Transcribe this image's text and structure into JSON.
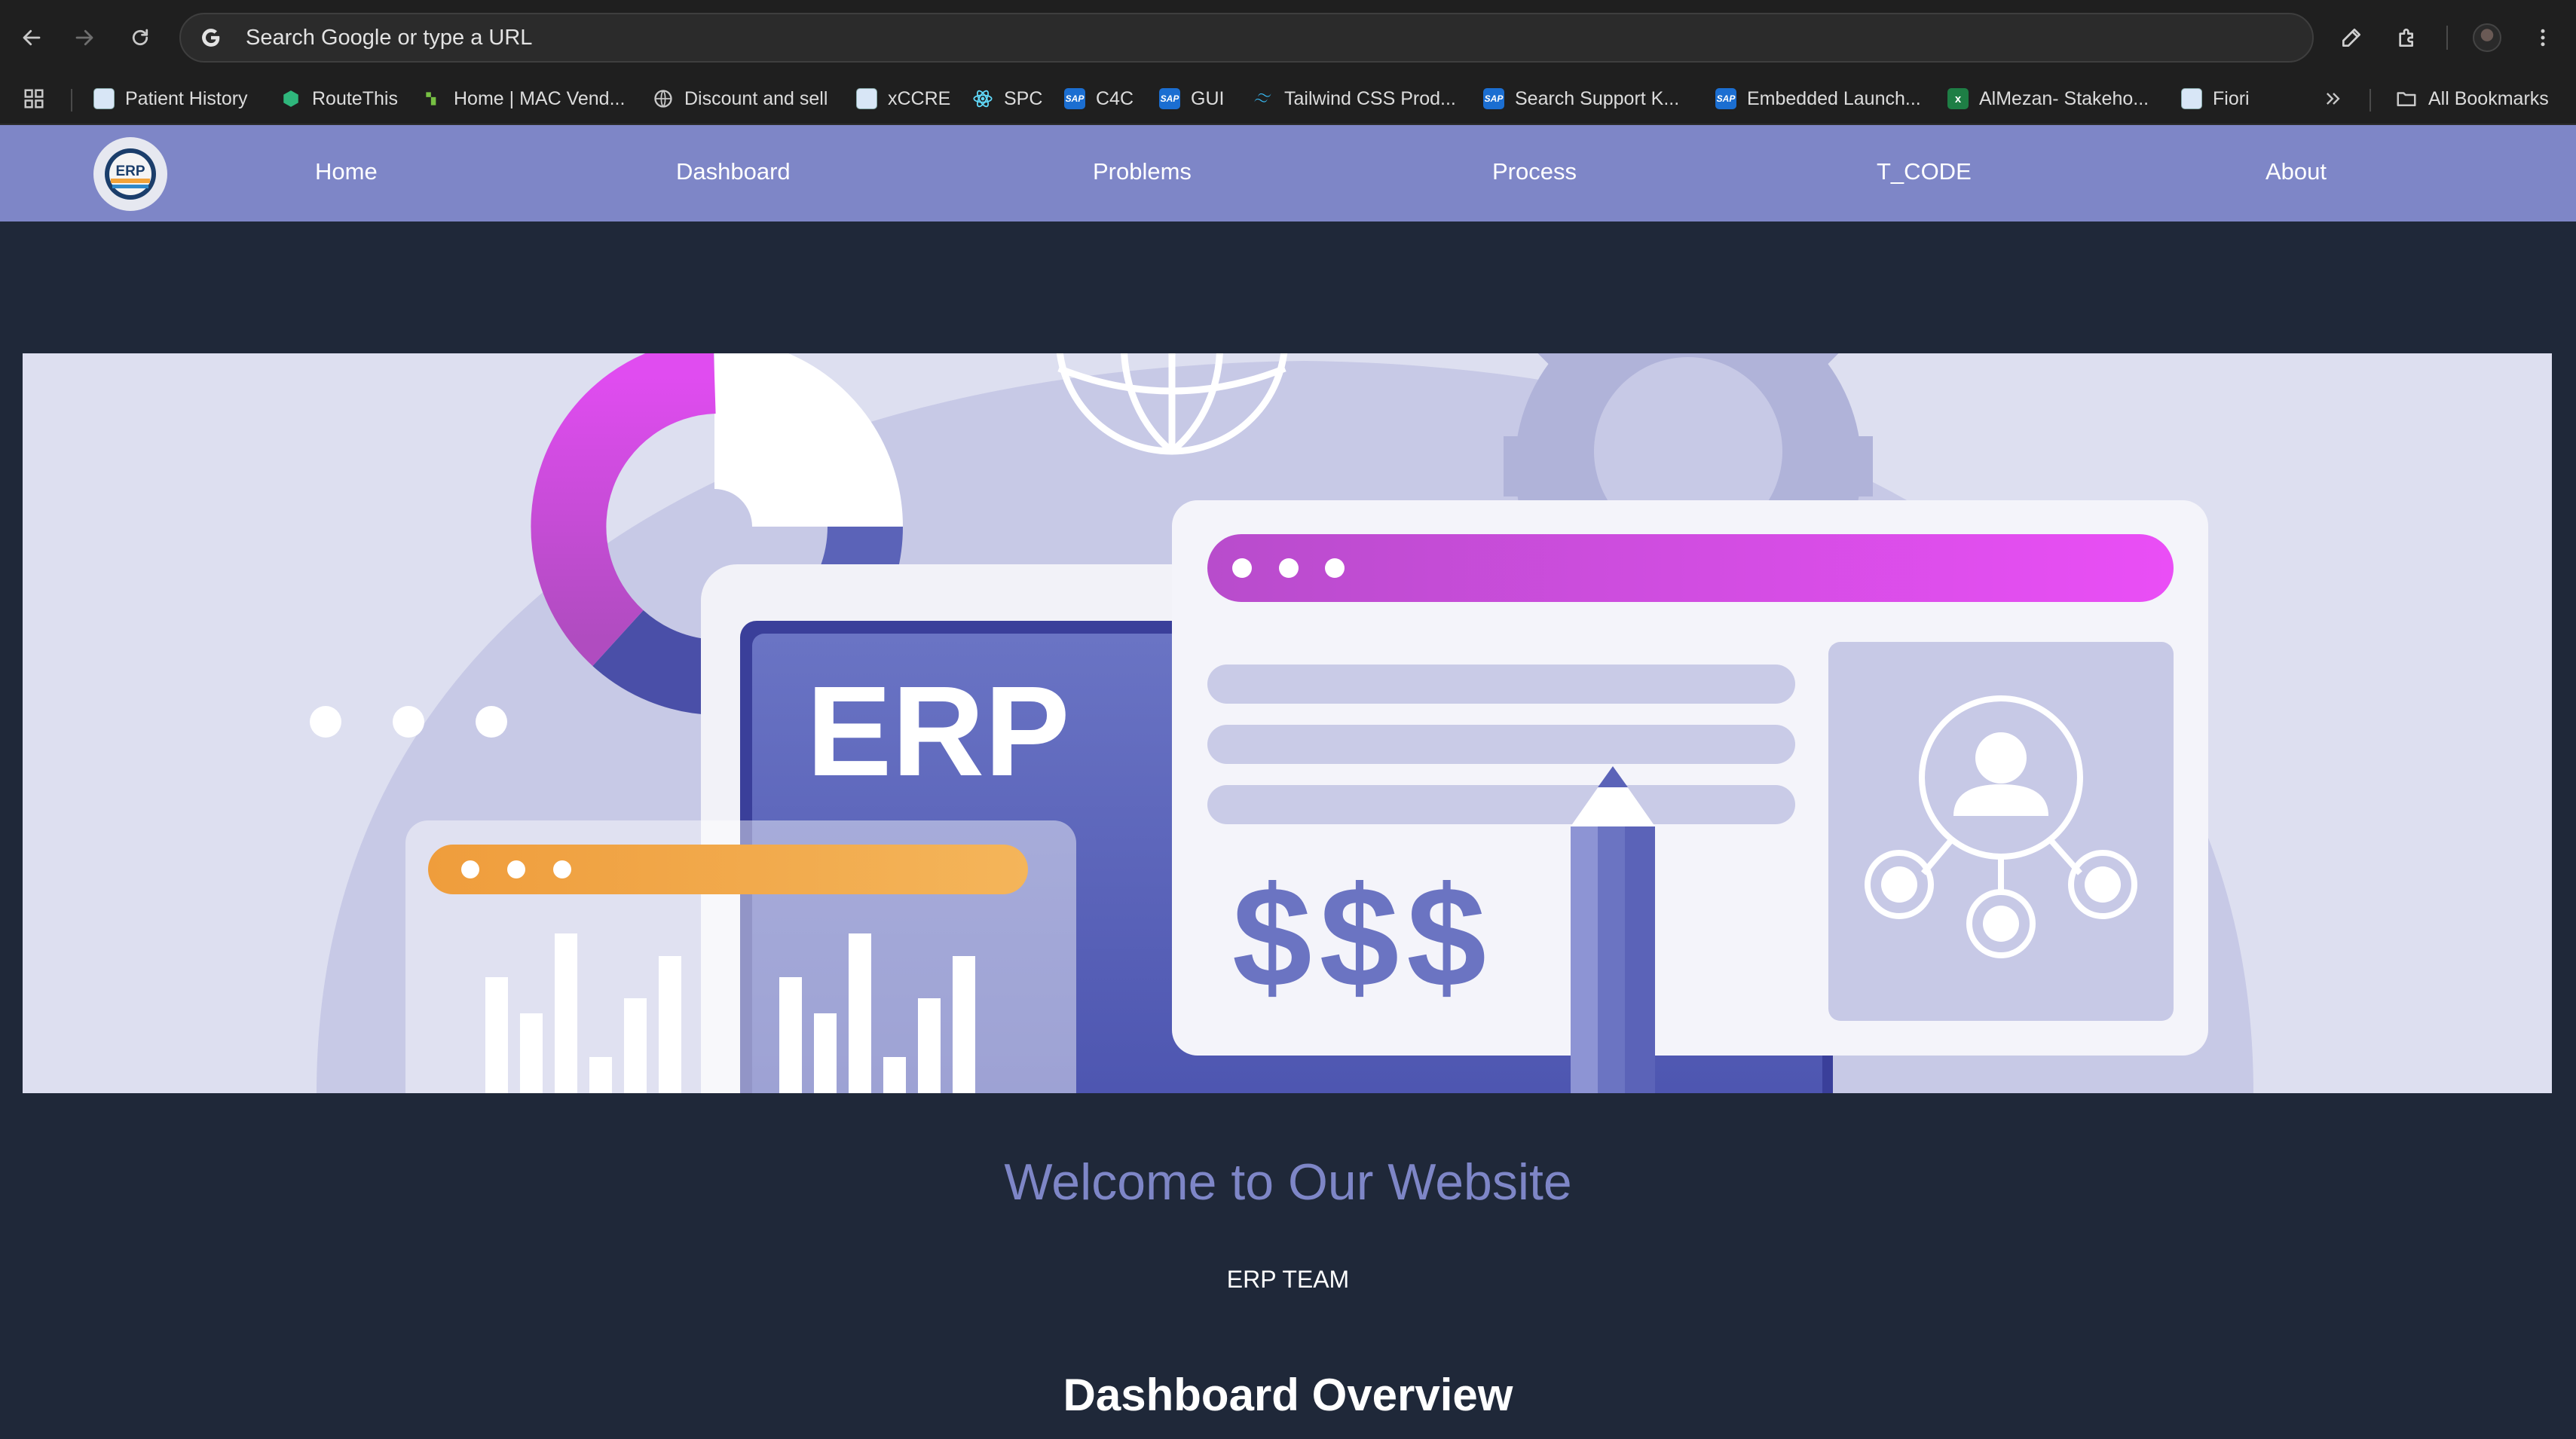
{
  "browser": {
    "address_placeholder": "Search Google or type a URL",
    "bookmarks": [
      {
        "label": "Patient History",
        "icon": "doc-icon"
      },
      {
        "label": "RouteThis",
        "icon": "routethis-icon"
      },
      {
        "label": "Home | MAC Vend...",
        "icon": "mac-icon"
      },
      {
        "label": "Discount and sell",
        "icon": "globe-icon"
      },
      {
        "label": "xCCRE",
        "icon": "doc-icon"
      },
      {
        "label": "SPC",
        "icon": "react-icon"
      },
      {
        "label": "C4C",
        "icon": "sap-icon"
      },
      {
        "label": "GUI",
        "icon": "sap-icon"
      },
      {
        "label": "Tailwind CSS Prod...",
        "icon": "tailwind-icon"
      },
      {
        "label": "Search Support K...",
        "icon": "sap-icon"
      },
      {
        "label": "Embedded Launch...",
        "icon": "sap-icon"
      },
      {
        "label": "AlMezan- Stakeho...",
        "icon": "excel-icon"
      },
      {
        "label": "Fiori",
        "icon": "doc-icon"
      }
    ],
    "all_bookmarks": "All Bookmarks",
    "sap_text": "SAP"
  },
  "site": {
    "logo_text": "ERP",
    "nav": [
      "Home",
      "Dashboard",
      "Problems",
      "Process",
      "T_CODE",
      "About"
    ]
  },
  "hero": {
    "screen_text": "ERP",
    "money_text": "$$$"
  },
  "content": {
    "welcome": "Welcome to Our Website",
    "team": "ERP TEAM",
    "dashboard_title": "Dashboard Overview"
  },
  "colors": {
    "navbar": "#7e86c7",
    "page_bg": "#1f2839",
    "accent_pink": "#e44df0",
    "accent_orange": "#f0a040"
  }
}
